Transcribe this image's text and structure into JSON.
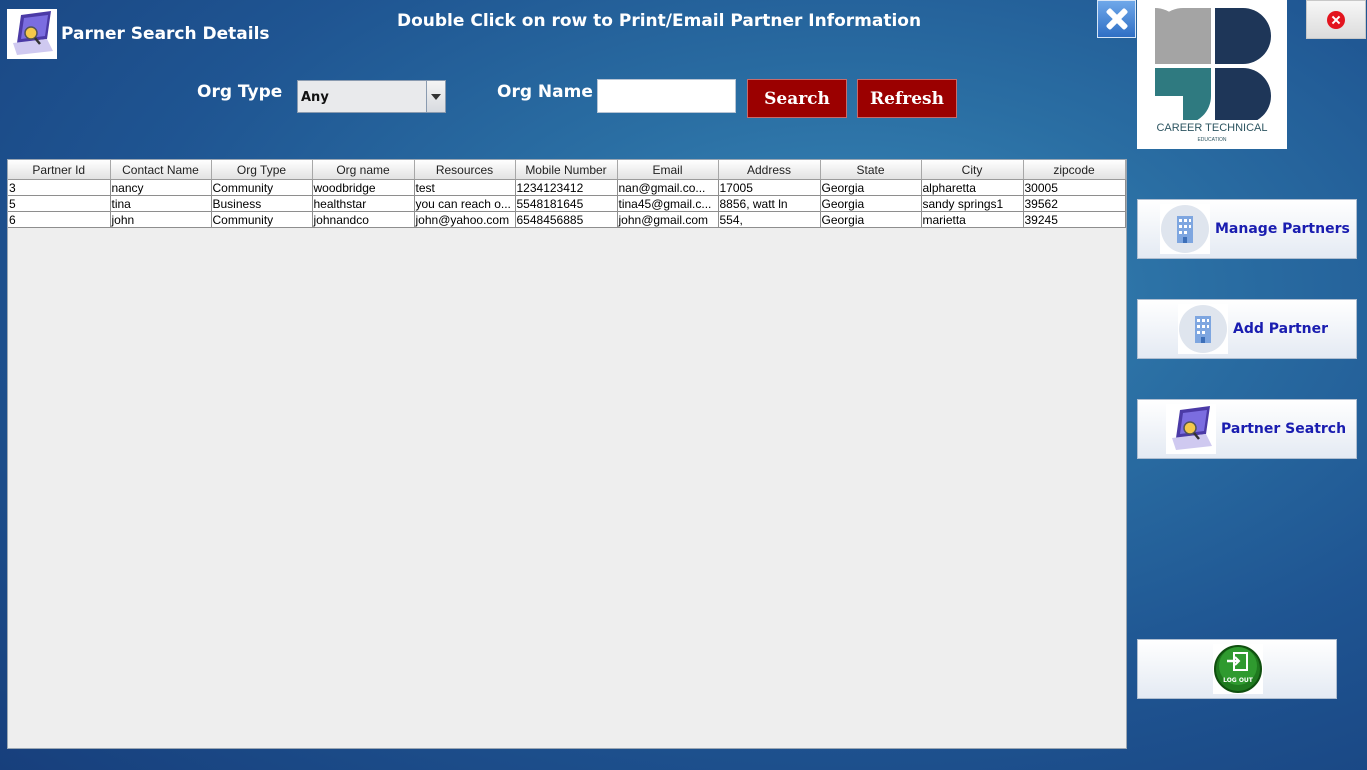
{
  "header": {
    "title": "Parner Search Details",
    "instruction": "Double Click on row to Print/Email Partner Information"
  },
  "filters": {
    "org_type_label": "Org Type",
    "org_type_value": "Any",
    "org_name_label": "Org Name",
    "org_name_value": "",
    "search_label": "Search",
    "refresh_label": "Refresh"
  },
  "logo": {
    "text": "CAREER TECHNICAL",
    "subtext": "EDUCATION"
  },
  "side_menu": {
    "manage_partners": "Manage Partners",
    "add_partner": "Add Partner",
    "partner_search": "Partner Seatrch",
    "logout_icon_text": "LOG OUT"
  },
  "table": {
    "columns": [
      "Partner Id",
      "Contact Name",
      "Org Type",
      "Org name",
      "Resources",
      "Mobile Number",
      "Email",
      "Address",
      "State",
      "City",
      "zipcode"
    ],
    "rows": [
      [
        "3",
        "nancy",
        "Community",
        "woodbridge",
        "test",
        "1234123412",
        "nan@gmail.co...",
        "17005",
        "Georgia",
        "alpharetta",
        "30005"
      ],
      [
        "5",
        "tina",
        "Business",
        "healthstar",
        "you can reach o...",
        "5548181645",
        "tina45@gmail.c...",
        "8856, watt ln",
        "Georgia",
        "sandy springs1",
        "39562"
      ],
      [
        "6",
        "john",
        "Community",
        "johnandco",
        "john@yahoo.com",
        "6548456885",
        "john@gmail.com",
        "554,",
        "Georgia",
        "marietta",
        "39245"
      ]
    ]
  },
  "colors": {
    "accent_red": "#9b0000",
    "side_label_blue": "#1a1db0",
    "logo_teal": "#2f7a80",
    "logo_navy": "#1e3658",
    "logo_gray": "#a4a4a4"
  },
  "icons": {
    "title_icon": "laptop-search-icon",
    "manage_icon": "building-icon",
    "add_icon": "building-icon",
    "search_icon": "laptop-search-icon",
    "logout_icon": "logout-door-icon",
    "close_icon": "close-x-icon",
    "exit_icon": "red-close-icon"
  }
}
